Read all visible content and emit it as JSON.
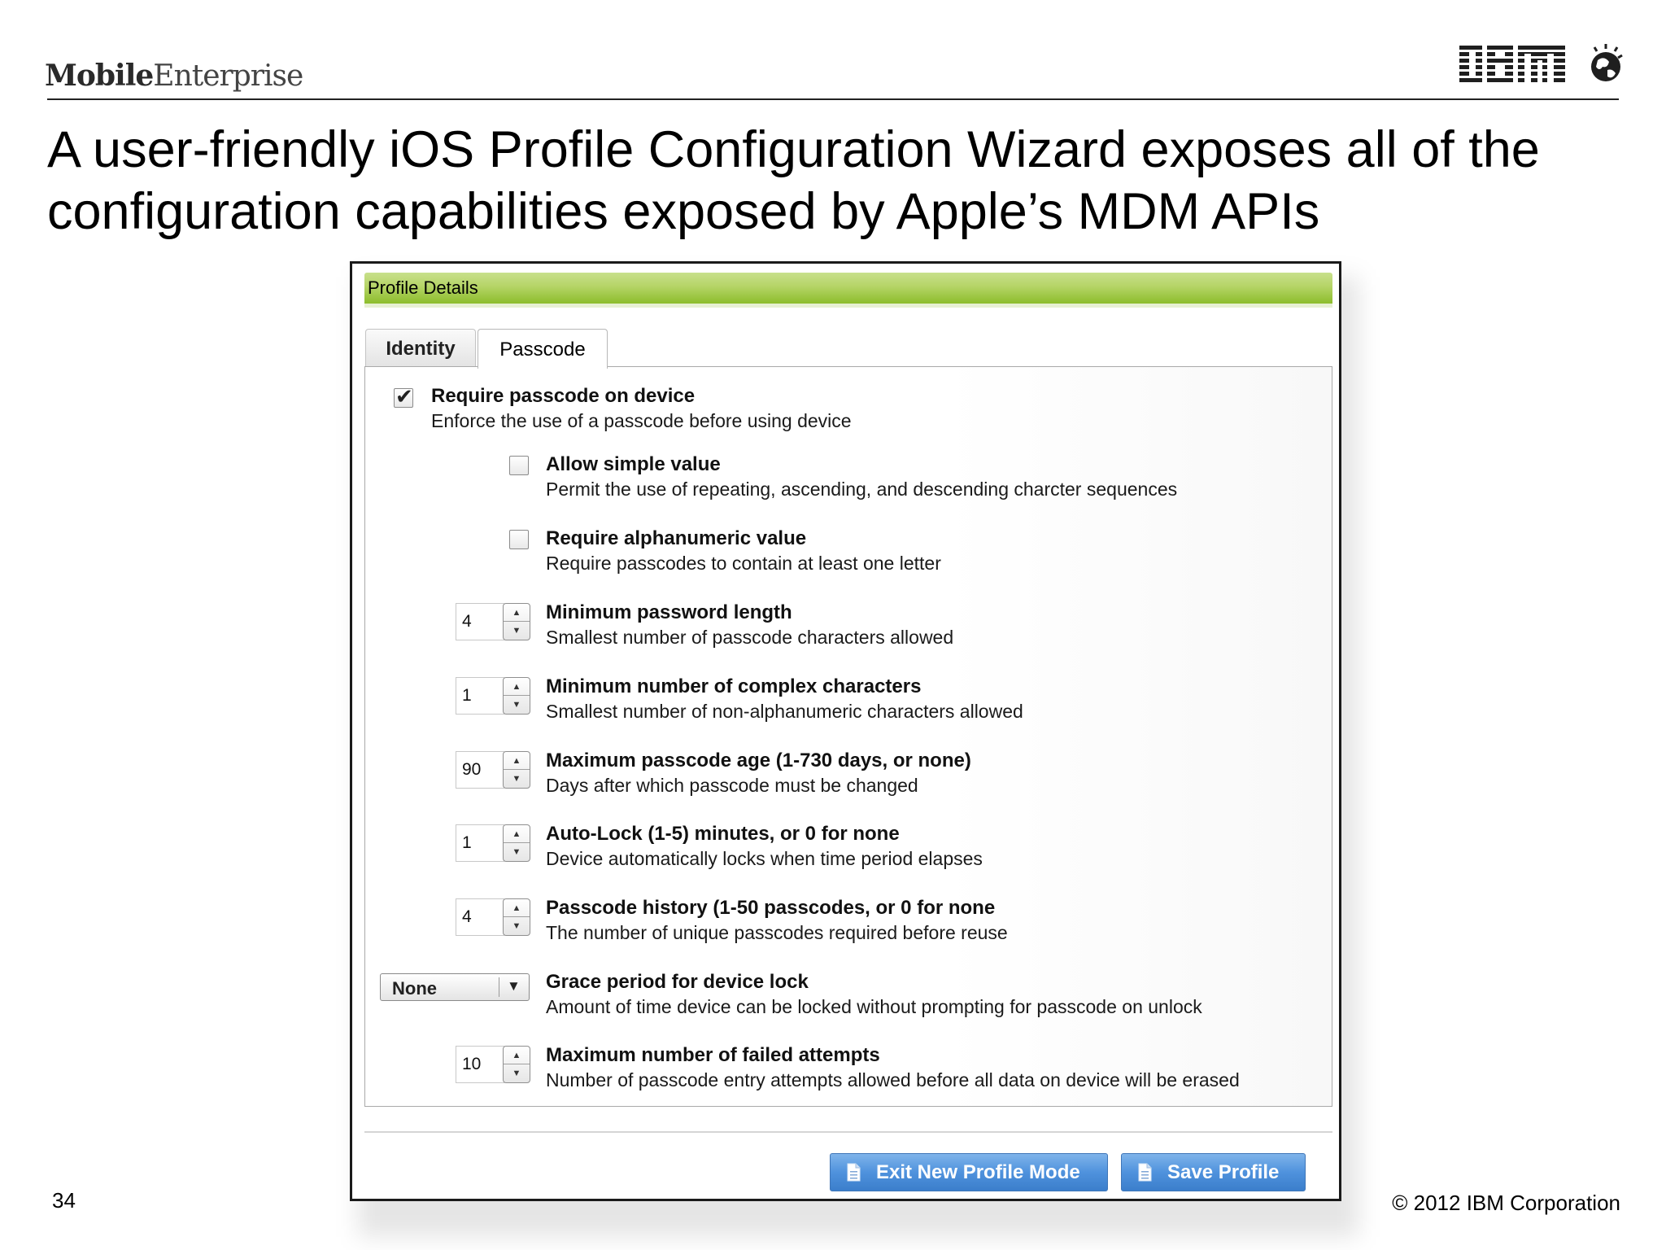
{
  "header": {
    "brand_bold": "Mobile",
    "brand_light": "Enterprise",
    "logo_text": "IBM",
    "title": "A user-friendly iOS Profile Configuration Wizard exposes all of the configuration capabilities exposed by Apple’s MDM APIs"
  },
  "footer": {
    "page_number": "34",
    "copyright": "© 2012 IBM Corporation"
  },
  "panel": {
    "section_title": "Profile Details",
    "tabs": [
      {
        "label": "Identity",
        "selected": false
      },
      {
        "label": "Passcode",
        "selected": true
      }
    ],
    "settings": [
      {
        "control": "checkbox",
        "checked": true,
        "title": "Require passcode on device",
        "description": "Enforce the use of a passcode before using device"
      },
      {
        "control": "checkbox",
        "checked": false,
        "title": "Allow simple value",
        "description": "Permit the use of repeating, ascending, and descending charcter sequences"
      },
      {
        "control": "checkbox",
        "checked": false,
        "title": "Require alphanumeric value",
        "description": "Require passcodes to contain at least one letter"
      },
      {
        "control": "spinner",
        "value": "4",
        "title": "Minimum password length",
        "description": "Smallest number of passcode characters allowed"
      },
      {
        "control": "spinner",
        "value": "1",
        "title": "Minimum number of complex characters",
        "description": "Smallest number of non-alphanumeric characters allowed"
      },
      {
        "control": "spinner",
        "value": "90",
        "title": "Maximum passcode age (1-730 days, or none)",
        "description": "Days after which passcode must be changed"
      },
      {
        "control": "spinner",
        "value": "1",
        "title": "Auto-Lock (1-5) minutes, or 0 for none",
        "description": "Device automatically locks when time period elapses"
      },
      {
        "control": "spinner",
        "value": "4",
        "title": "Passcode history (1-50 passcodes, or 0 for none",
        "description": "The number of unique passcodes required before reuse"
      },
      {
        "control": "select",
        "value": "None",
        "title": "Grace period for device lock",
        "description": "Amount of time device can be locked without prompting for passcode on unlock"
      },
      {
        "control": "spinner",
        "value": "10",
        "title": "Maximum number of failed attempts",
        "description": "Number of passcode entry attempts allowed before all data on device will be erased"
      }
    ],
    "buttons": {
      "exit_label": "Exit New Profile Mode",
      "save_label": "Save Profile"
    }
  },
  "colors": {
    "section_bar": "#a6cc4a",
    "button_blue": "#4f92dd"
  },
  "icons": {
    "spinner_up": "▲",
    "spinner_down": "▼",
    "select_arrow": "▼",
    "checkmark": "✔",
    "button_icon": "document-icon"
  }
}
